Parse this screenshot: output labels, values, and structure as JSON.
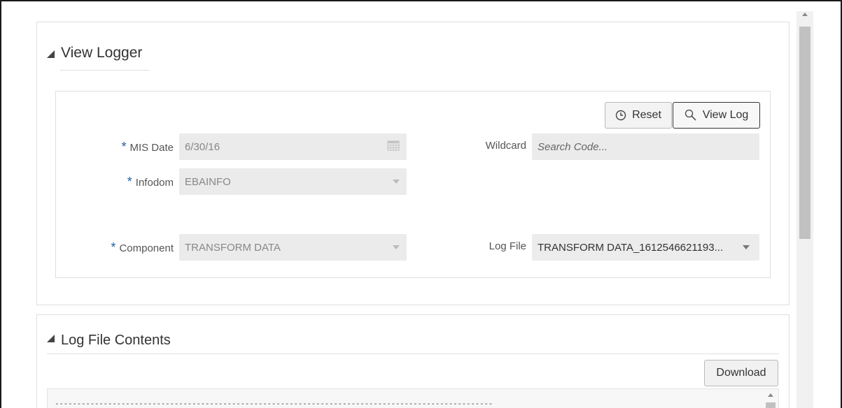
{
  "view_logger": {
    "title": "View Logger",
    "buttons": {
      "reset": "Reset",
      "view_log": "View Log"
    },
    "fields": {
      "mis_date": {
        "label": "MIS Date",
        "value": "6/30/16",
        "required": "*"
      },
      "infodom": {
        "label": "Infodom",
        "value": "EBAINFO",
        "required": "*"
      },
      "component": {
        "label": "Component",
        "value": "TRANSFORM DATA",
        "required": "*"
      },
      "wildcard": {
        "label": "Wildcard",
        "placeholder": "Search Code..."
      },
      "log_file": {
        "label": "Log File",
        "value": "TRANSFORM DATA_1612546621193..."
      }
    }
  },
  "log_contents": {
    "title": "Log File Contents",
    "download_label": "Download",
    "first_line": "---------------------------------------------------------------------------------------------------"
  },
  "colors": {
    "required_star": "#1f5fa6",
    "field_bg": "#ebebeb",
    "border": "#dedede"
  },
  "icons": [
    "collapse-triangle-icon",
    "clock-icon",
    "search-icon",
    "calendar-icon",
    "dropdown-arrow-icon"
  ]
}
